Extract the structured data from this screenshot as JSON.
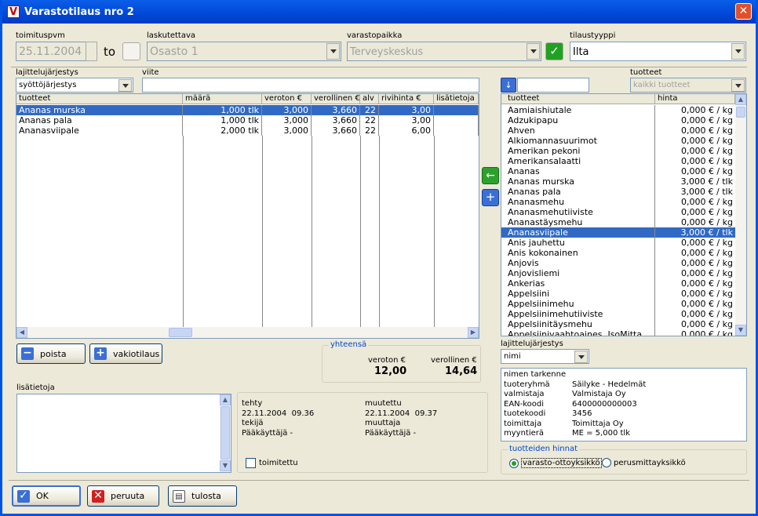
{
  "window": {
    "title": "Varastotilaus nro 2",
    "close": "✕",
    "app_letter": "V"
  },
  "header": {
    "toimituspvm_label": "toimituspvm",
    "toimituspvm_value": "25.11.2004",
    "to_label": "to",
    "laskutettava_label": "laskutettava",
    "laskutettava_value": "Osasto 1",
    "varastopaikka_label": "varastopaikka",
    "varastopaikka_value": "Terveyskeskus",
    "tilaustyyppi_label": "tilaustyyppi",
    "tilaustyyppi_value": "Ilta"
  },
  "order": {
    "sort_label": "lajittelujärjestys",
    "sort_value": "syöttöjärjestys",
    "viite_label": "viite",
    "viite_value": "",
    "columns": [
      "tuotteet",
      "määrä",
      "veroton €",
      "verollinen €",
      "alv",
      "rivihinta €",
      "lisätietoja"
    ],
    "rows": [
      [
        "Ananas murska",
        "1,000 tlk",
        "3,000",
        "3,660",
        "22",
        "3,00",
        ""
      ],
      [
        "Ananas pala",
        "1,000 tlk",
        "3,000",
        "3,660",
        "22",
        "3,00",
        ""
      ],
      [
        "Ananasviipale",
        "2,000 tlk",
        "3,000",
        "3,660",
        "22",
        "6,00",
        ""
      ]
    ]
  },
  "buttons": {
    "poista": "poista",
    "vakiotilaus": "vakiotilaus",
    "ok": "OK",
    "peruuta": "peruuta",
    "tulosta": "tulosta"
  },
  "totals": {
    "legend": "yhteensä",
    "veroton_label": "veroton €",
    "veroton_value": "12,00",
    "verollinen_label": "verollinen €",
    "verollinen_value": "14,64"
  },
  "lisatietoja_label": "lisätietoja",
  "meta": {
    "tehty_label": "tehty",
    "tehty_value": "22.11.2004  09.36",
    "tekija_label": "tekijä",
    "tekija_value": "Pääkäyttäjä -",
    "muutettu_label": "muutettu",
    "muutettu_value": "22.11.2004  09.37",
    "muuttaja_label": "muuttaja",
    "muuttaja_value": "Pääkäyttäjä -",
    "toimitettu_label": "toimitettu"
  },
  "products": {
    "label": "tuotteet",
    "filter_value": "kaikki tuotteet",
    "search_value": "",
    "columns": [
      "tuotteet",
      "hinta"
    ],
    "rows": [
      [
        "Aamiaishiutale",
        "0,000 € / kg"
      ],
      [
        "Adzukipapu",
        "0,000 € / kg"
      ],
      [
        "Ahven",
        "0,000 € / kg"
      ],
      [
        "Alkiomannasuurimot",
        "0,000 € / kg"
      ],
      [
        "Amerikan pekoni",
        "0,000 € / kg"
      ],
      [
        "Amerikansalaatti",
        "0,000 € / kg"
      ],
      [
        "Ananas",
        "0,000 € / kg"
      ],
      [
        "Ananas murska",
        "3,000 € / tlk"
      ],
      [
        "Ananas pala",
        "3,000 € / tlk"
      ],
      [
        "Ananasmehu",
        "0,000 € / kg"
      ],
      [
        "Ananasmehutiiviste",
        "0,000 € / kg"
      ],
      [
        "Ananastäysmehu",
        "0,000 € / kg"
      ],
      [
        "Ananasviipale",
        "3,000 € / tlk"
      ],
      [
        "Anis jauhettu",
        "0,000 € / kg"
      ],
      [
        "Anis kokonainen",
        "0,000 € / kg"
      ],
      [
        "Anjovis",
        "0,000 € / kg"
      ],
      [
        "Anjovisliemi",
        "0,000 € / kg"
      ],
      [
        "Ankerias",
        "0,000 € / kg"
      ],
      [
        "Appelsiini",
        "0,000 € / kg"
      ],
      [
        "Appelsiinimehu",
        "0,000 € / kg"
      ],
      [
        "Appelsiinimehutiiviste",
        "0,000 € / kg"
      ],
      [
        "Appelsiinitäysmehu",
        "0,000 € / kg"
      ],
      [
        "Appelsiinivaahtoaines, IsoMitta",
        "0,000 € / kg"
      ]
    ],
    "selected_index": 12,
    "sort_label": "lajittelujärjestys",
    "sort_value": "nimi"
  },
  "detail": [
    [
      "nimen tarkenne",
      ""
    ],
    [
      "tuoteryhmä",
      "Säilyke - Hedelmät"
    ],
    [
      "valmistaja",
      "Valmistaja Oy"
    ],
    [
      "EAN-koodi",
      "6400000000003"
    ],
    [
      "tuotekoodi",
      "3456"
    ],
    [
      "toimittaja",
      "Toimittaja Oy"
    ],
    [
      "myyntierä",
      "ME = 5,000 tlk"
    ]
  ],
  "prices": {
    "legend": "tuotteiden hinnat",
    "opt1": "varasto-ottoyksikkö",
    "opt2": "perusmittayksikkö"
  }
}
